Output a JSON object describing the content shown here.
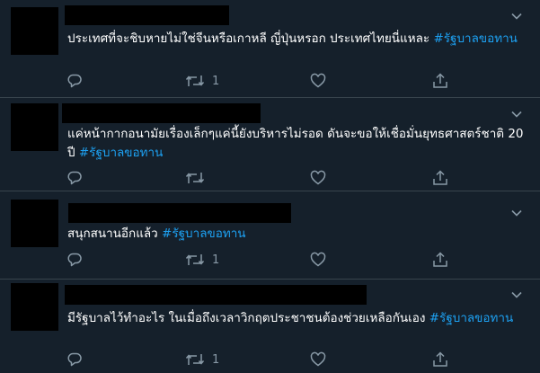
{
  "colors": {
    "background": "#15202b",
    "divider": "#38444d",
    "text": "#ffffff",
    "hashtag": "#1da1f2",
    "icon": "#8899a6",
    "redaction": "#000000"
  },
  "tweets": [
    {
      "text": "ประเทศที่จะชิบหายไม่ใช่จีนหรือเกาหลี ญี่ปุ่นหรอก  ประเทศไทยนี่แหละ ",
      "hashtag": "#รัฐบาลขอทาน",
      "retweet_count": "1",
      "icons": [
        "reply-icon",
        "retweet-icon",
        "like-icon",
        "share-icon",
        "chevron-down-icon"
      ]
    },
    {
      "text": "แค่หน้ากากอนามัยเรื่องเล็กๆแค่นี้ยังบริหารไม่รอด ดันจะขอให้เชื่อมั่นยุทธศาสตร์ชาติ 20 ปี  ",
      "hashtag": "#รัฐบาลขอทาน",
      "retweet_count": "",
      "icons": [
        "reply-icon",
        "retweet-icon",
        "like-icon",
        "share-icon",
        "chevron-down-icon"
      ]
    },
    {
      "text": "สนุกสนานอีกแล้ว ",
      "hashtag": "#รัฐบาลขอทาน",
      "retweet_count": "1",
      "icons": [
        "reply-icon",
        "retweet-icon",
        "like-icon",
        "share-icon",
        "chevron-down-icon"
      ]
    },
    {
      "text": "มีรัฐบาลไว้ทำอะไร ในเมื่อถึงเวลาวิกฤตประชาชนต้องช่วยเหลือกันเอง ",
      "hashtag": "#รัฐบาลขอทาน",
      "retweet_count": "1",
      "icons": [
        "reply-icon",
        "retweet-icon",
        "like-icon",
        "share-icon",
        "chevron-down-icon"
      ]
    }
  ]
}
